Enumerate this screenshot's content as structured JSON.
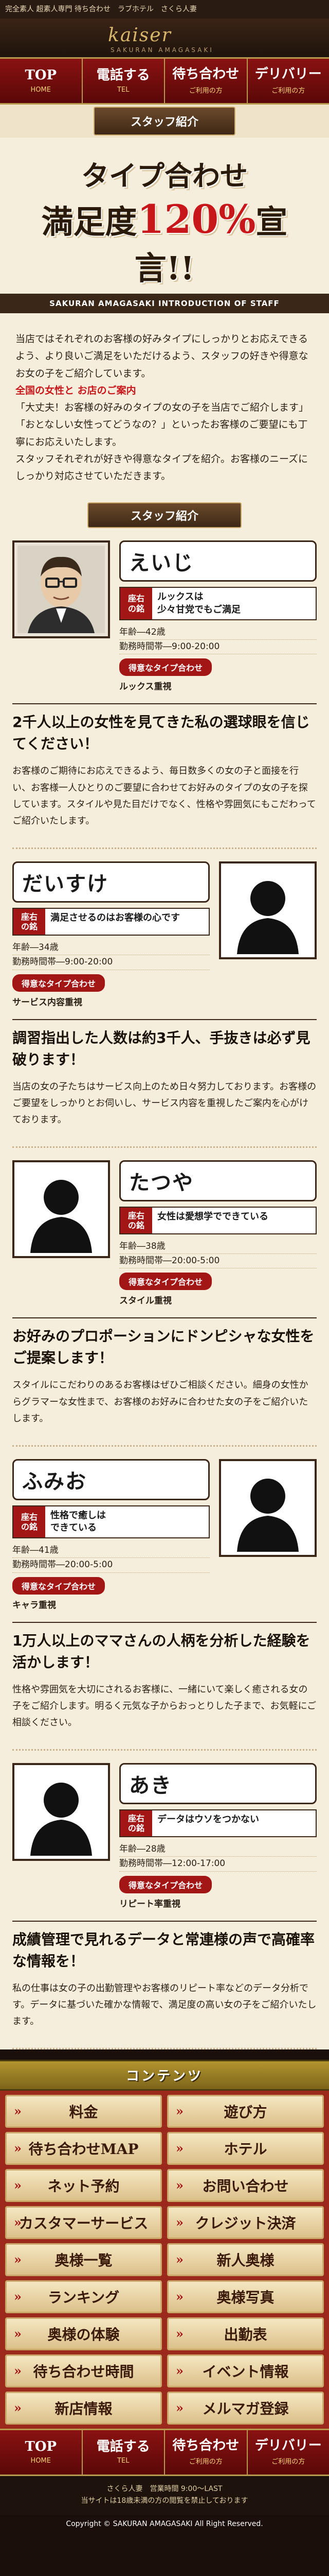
{
  "header": {
    "strip": "完全素人 超素人専門 待ち合わせ　ラブホテル　さくら人妻",
    "logo": "kaiser",
    "logo_sub": "SAKURAN AMAGASAKI",
    "nav": [
      {
        "main": "TOP",
        "sub": "HOME"
      },
      {
        "main": "電話する",
        "sub": "TEL"
      },
      {
        "main": "待ち合わせ",
        "sub": "ご利用の方"
      },
      {
        "main": "デリバリー",
        "sub": "ご利用の方"
      }
    ]
  },
  "section_title": "スタッフ紹介",
  "hero": {
    "line1": "タイプ合わせ",
    "line2_pre": "満足度",
    "line2_pct": "120%",
    "line2_post": "宣言!!",
    "en": "SAKURAN AMAGASAKI INTRODUCTION OF STAFF"
  },
  "intro": {
    "p1": "当店ではそれぞれのお客様の好みタイプにしっかりとお応えできるよう、より良いご満足をいただけるよう、スタッフの好きや得意なお女の子をご紹介しています。",
    "p2_red": "全国の女性と お店のご案内",
    "p3": "「大丈夫！お客様の好みのタイプの女の子を当店でご紹介します」「おとなしい女性ってどうなの？」といったお客様のご要望にも丁寧にお応えいたします。",
    "p4": "スタッフそれぞれが好きや得意なタイプを紹介。お客様のニーズにしっかり対応させていただきます。"
  },
  "staff_banner": "スタッフ紹介",
  "staff": [
    {
      "name": "えいじ",
      "tag": "座右の銘",
      "motto": "ルックスは\n少々甘党でもご満足",
      "age": "年齢―42歳",
      "hours": "勤務時間帯―9:00-20:00",
      "type_label": "得意なタイプ合わせ",
      "type": "ルックス重視",
      "headline": "2千人以上の女性を見てきた私の選球眼を信じてください！",
      "body": "お客様のご期待にお応えできるよう、毎日数多くの女の子と面接を行い、お客様一人ひとりのご要望に合わせてお好みのタイプの女の子を探しています。スタイルや見た目だけでなく、性格や雰囲気にもこだわってご紹介いたします。"
    },
    {
      "name": "だいすけ",
      "tag": "座右の銘",
      "motto": "満足させるのはお客様の心です",
      "age": "年齢―34歳",
      "hours": "勤務時間帯―9:00-20:00",
      "type_label": "得意なタイプ合わせ",
      "type": "サービス内容重視",
      "headline": "調習指出した人数は約3千人、手抜きは必ず見破ります！",
      "body": "当店の女の子たちはサービス向上のため日々努力しております。お客様のご要望をしっかりとお伺いし、サービス内容を重視したご案内を心がけております。"
    },
    {
      "name": "たつや",
      "tag": "座右の銘",
      "motto": "女性は愛想学でできている",
      "age": "年齢―38歳",
      "hours": "勤務時間帯―20:00-5:00",
      "type_label": "得意なタイプ合わせ",
      "type": "スタイル重視",
      "headline": "お好みのプロポーションにドンピシャな女性をご提案します！",
      "body": "スタイルにこだわりのあるお客様はぜひご相談ください。細身の女性からグラマーな女性まで、お客様のお好みに合わせた女の子をご紹介いたします。"
    },
    {
      "name": "ふみお",
      "tag": "座右の銘",
      "motto": "性格で癒しは\nできている",
      "age": "年齢―41歳",
      "hours": "勤務時間帯―20:00-5:00",
      "type_label": "得意なタイプ合わせ",
      "type": "キャラ重視",
      "headline": "1万人以上のママさんの人柄を分析した経験を活かします！",
      "body": "性格や雰囲気を大切にされるお客様に、一緒にいて楽しく癒される女の子をご紹介します。明るく元気な子からおっとりした子まで、お気軽にご相談ください。"
    },
    {
      "name": "あき",
      "tag": "座右の銘",
      "motto": "データはウソをつかない",
      "age": "年齢―28歳",
      "hours": "勤務時間帯―12:00-17:00",
      "type_label": "得意なタイプ合わせ",
      "type": "リピート率重視",
      "headline": "成績管理で見れるデータと常連様の声で高確率な情報を！",
      "body": "私の仕事は女の子の出勤管理やお客様のリピート率などのデータ分析です。データに基づいた確かな情報で、満足度の高い女の子をご紹介いたします。"
    }
  ],
  "contents": {
    "title": "コンテンツ",
    "items": [
      "料金",
      "遊び方",
      "待ち合わせMAP",
      "ホテル",
      "ネット予約",
      "お問い合わせ",
      "カスタマーサービス",
      "クレジット決済",
      "奥様一覧",
      "新人奥様",
      "ランキング",
      "奥様写真",
      "奥様の体験",
      "出勤表",
      "待ち合わせ時間",
      "イベント情報",
      "新店情報",
      "メルマガ登録"
    ]
  },
  "footer": {
    "nav": [
      {
        "main": "TOP",
        "sub": "HOME"
      },
      {
        "main": "電話する",
        "sub": "TEL"
      },
      {
        "main": "待ち合わせ",
        "sub": "ご利用の方"
      },
      {
        "main": "デリバリー",
        "sub": "ご利用の方"
      }
    ],
    "info": "さくら人妻　営業時間 9:00～LAST",
    "notice": "当サイトは18歳未満の方の閲覧を禁止しております",
    "copy": "Copyright © SAKURAN AMAGASAKI All Right Reserved."
  }
}
